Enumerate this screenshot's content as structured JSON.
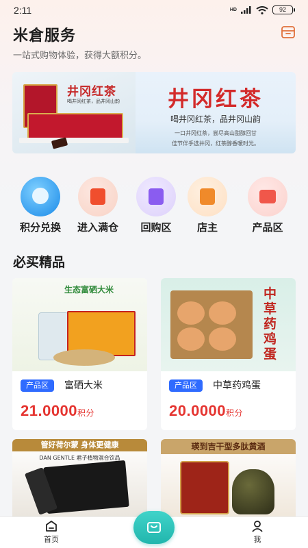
{
  "status_bar": {
    "time": "2:11",
    "network": "HD",
    "battery": "92"
  },
  "header": {
    "title": "米倉服务",
    "subtitle": "一站式购物体验，获得大额积分。"
  },
  "banner": {
    "left_title": "井冈红茶",
    "left_slogan": "喝井冈红茶，品井冈山韵",
    "heading": "井冈红茶",
    "slogan": "喝井冈红茶，品井冈山韵",
    "line1": "一口井冈红茶，尝尽高山甜醇回甘",
    "line2": "佳节伴手选井冈，红茶醇香暖时光。"
  },
  "categories": [
    {
      "label": "积分兑换",
      "icon": "points-exchange-icon"
    },
    {
      "label": "进入满仓",
      "icon": "shop-icon"
    },
    {
      "label": "回购区",
      "icon": "buyback-icon"
    },
    {
      "label": "店主",
      "icon": "store-owner-icon"
    },
    {
      "label": "产品区",
      "icon": "product-icon"
    }
  ],
  "section": {
    "title": "必买精品"
  },
  "products": [
    {
      "tag": "产品区",
      "name": "富硒大米",
      "price": "21.0000",
      "unit": "积分",
      "image_text": "生态富硒大米"
    },
    {
      "tag": "产品区",
      "name": "中草药鸡蛋",
      "price": "20.0000",
      "unit": "积分",
      "image_text": "中草药鸡蛋"
    },
    {
      "tag": "",
      "name": "",
      "price": "",
      "unit": "",
      "image_text": "管好荷尔蒙 身体更健康",
      "image_sub": "DAN GENTLE 君子植物混合饮品"
    },
    {
      "tag": "",
      "name": "",
      "price": "",
      "unit": "",
      "image_text": "瑛到吉干型多肽黄酒"
    }
  ],
  "tabbar": {
    "home_label": "首页",
    "me_label": "我"
  },
  "colors": {
    "accent": "#2f6bff",
    "price": "#e53430",
    "teal": "#21b6ad"
  }
}
